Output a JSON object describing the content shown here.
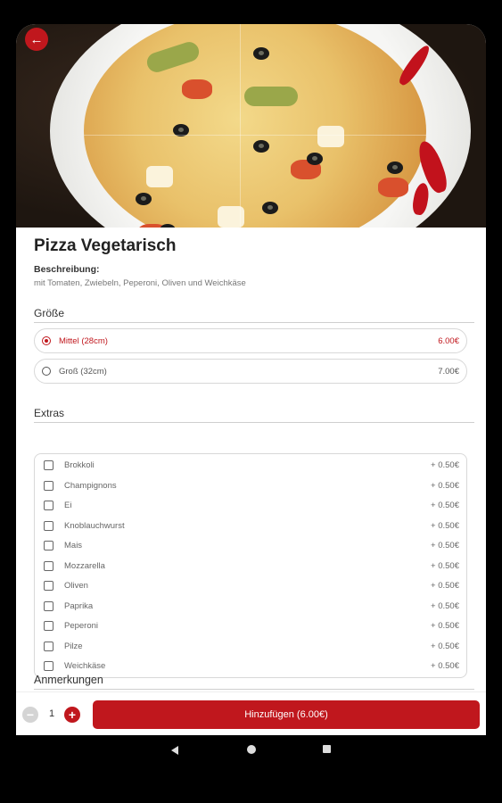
{
  "product": {
    "title": "Pizza Vegetarisch",
    "description_label": "Beschreibung:",
    "description": "mit Tomaten, Zwiebeln, Peperoni, Oliven und Weichkäse"
  },
  "size_section": {
    "heading": "Größe",
    "options": [
      {
        "label": "Mittel (28cm)",
        "price": "6.00€",
        "selected": true
      },
      {
        "label": "Groß (32cm)",
        "price": "7.00€",
        "selected": false
      }
    ]
  },
  "extras_section": {
    "heading": "Extras",
    "items": [
      {
        "label": "Brokkoli",
        "price": "+ 0.50€"
      },
      {
        "label": "Champignons",
        "price": "+ 0.50€"
      },
      {
        "label": "Ei",
        "price": "+ 0.50€"
      },
      {
        "label": "Knoblauchwurst",
        "price": "+ 0.50€"
      },
      {
        "label": "Mais",
        "price": "+ 0.50€"
      },
      {
        "label": "Mozzarella",
        "price": "+ 0.50€"
      },
      {
        "label": "Oliven",
        "price": "+ 0.50€"
      },
      {
        "label": "Paprika",
        "price": "+ 0.50€"
      },
      {
        "label": "Peperoni",
        "price": "+ 0.50€"
      },
      {
        "label": "Pilze",
        "price": "+ 0.50€"
      },
      {
        "label": "Weichkäse",
        "price": "+ 0.50€"
      }
    ]
  },
  "notes_section": {
    "heading": "Anmerkungen"
  },
  "cart": {
    "quantity": "1",
    "minus_icon": "−",
    "plus_icon": "+",
    "add_button_label": "Hinzufügen (6.00€)"
  },
  "icons": {
    "back": "back-arrow-icon",
    "nav_back": "nav-back-icon",
    "nav_home": "nav-home-icon",
    "nav_recent": "nav-recent-icon"
  },
  "colors": {
    "accent": "#c0171d",
    "disabled": "#d4d4d4",
    "text": "#333333",
    "muted": "#777777"
  }
}
